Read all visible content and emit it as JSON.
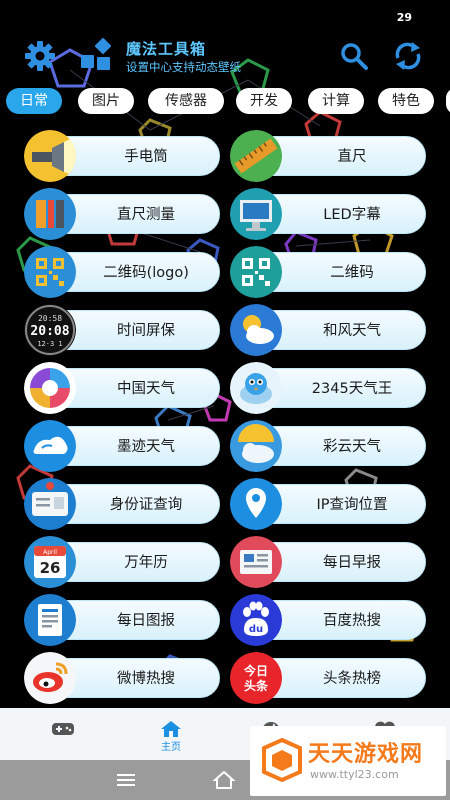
{
  "status": {
    "time": "29"
  },
  "header": {
    "title": "魔法工具箱",
    "subtitle": "设置中心支持动态壁纸",
    "left_icons": [
      "gear-icon",
      "widgets-icon"
    ],
    "right_icons": [
      "search-icon",
      "refresh-icon"
    ]
  },
  "tabs": [
    {
      "label": "日常",
      "active": true
    },
    {
      "label": "图片",
      "active": false
    },
    {
      "label": "传感器",
      "active": false
    },
    {
      "label": "开发",
      "active": false
    },
    {
      "label": "计算",
      "active": false
    },
    {
      "label": "特色",
      "active": false
    }
  ],
  "tools": [
    {
      "label": "手电筒",
      "icon": "flashlight-icon"
    },
    {
      "label": "直尺",
      "icon": "ruler-icon"
    },
    {
      "label": "直尺测量",
      "icon": "measure-tools-icon"
    },
    {
      "label": "LED字幕",
      "icon": "monitor-icon"
    },
    {
      "label": "二维码(logo)",
      "icon": "qr-logo-icon"
    },
    {
      "label": "二维码",
      "icon": "qr-code-icon"
    },
    {
      "label": "时间屏保",
      "icon": "digital-clock-icon"
    },
    {
      "label": "和风天气",
      "icon": "sun-cloud-icon"
    },
    {
      "label": "中国天气",
      "icon": "china-weather-icon"
    },
    {
      "label": "2345天气王",
      "icon": "bird-weather-icon"
    },
    {
      "label": "墨迹天气",
      "icon": "ink-weather-icon"
    },
    {
      "label": "彩云天气",
      "icon": "caiyun-weather-icon"
    },
    {
      "label": "身份证查询",
      "icon": "id-card-icon"
    },
    {
      "label": "IP查询位置",
      "icon": "location-pin-icon"
    },
    {
      "label": "万年历",
      "icon": "calendar-icon"
    },
    {
      "label": "每日早报",
      "icon": "newspaper-icon"
    },
    {
      "label": "每日图报",
      "icon": "document-icon"
    },
    {
      "label": "百度热搜",
      "icon": "baidu-paw-icon"
    },
    {
      "label": "微博热搜",
      "icon": "weibo-icon"
    },
    {
      "label": "头条热榜",
      "icon": "toutiao-icon"
    }
  ],
  "icon_text": {
    "clock_line1": "20:58",
    "clock_line2": "20:08",
    "clock_line3": "12·3 1",
    "calendar_month": "April",
    "calendar_day": "26",
    "baidu": "du",
    "toutiao_top": "今日",
    "toutiao_bottom": "头条"
  },
  "bottom_nav": {
    "items": [
      {
        "icon": "gamepad-icon",
        "label": ""
      },
      {
        "icon": "home-icon",
        "label": "主页",
        "active": true
      },
      {
        "icon": "globe-icon",
        "label": ""
      },
      {
        "icon": "heart-icon",
        "label": ""
      }
    ]
  },
  "watermark": {
    "name": "天天游戏网",
    "url": "www.ttyl23.com"
  },
  "colors": {
    "accent": "#2aa6ea",
    "title": "#5ec8ff",
    "pill": "#e6f6fd",
    "background": "#000000"
  }
}
